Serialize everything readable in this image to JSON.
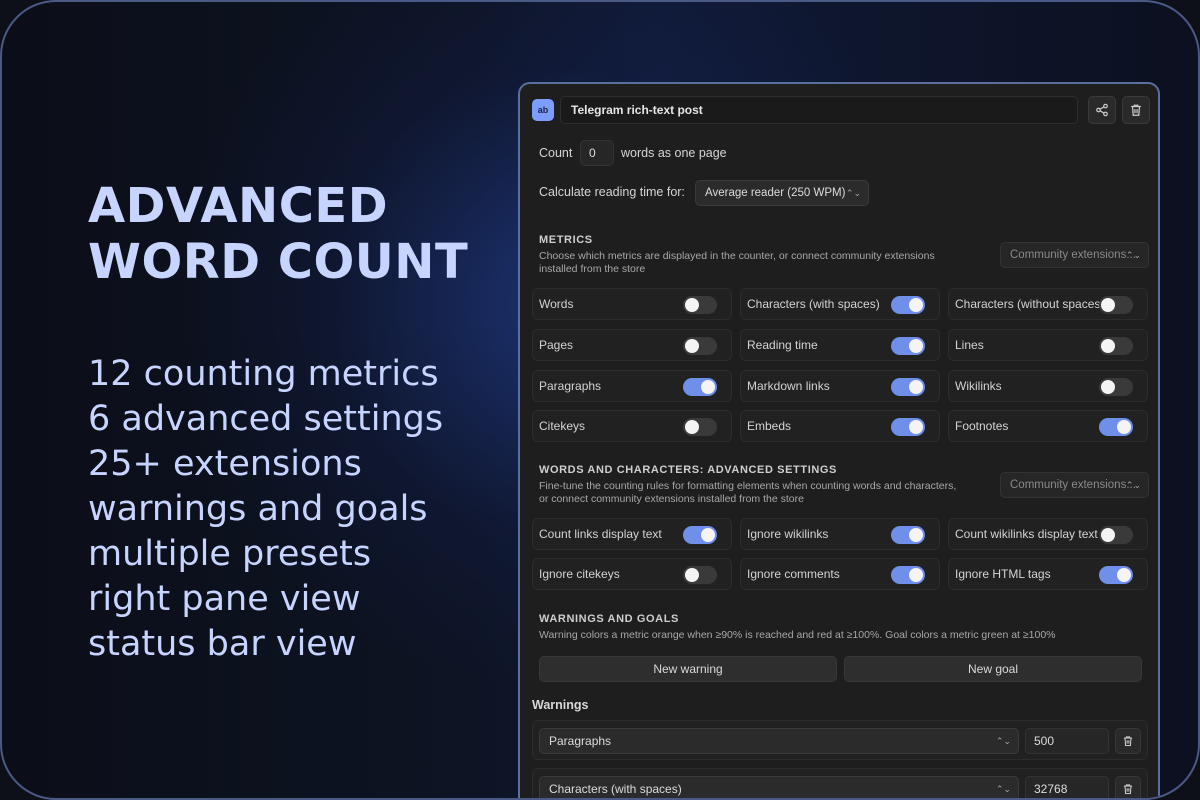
{
  "hero": {
    "title_line1": "ADVANCED",
    "title_line2": "WORD COUNT",
    "features": [
      "12 counting metrics",
      "6 advanced settings",
      "25+ extensions",
      "warnings and goals",
      "multiple presets",
      "right pane view",
      "status bar view"
    ]
  },
  "panel": {
    "app_icon": "ab",
    "preset_name": "Telegram rich-text post",
    "share_icon": "share-icon",
    "trash_icon": "trash-icon",
    "page": {
      "prefix": "Count",
      "value": "0",
      "suffix": "words as one page"
    },
    "reading": {
      "label": "Calculate reading time for:",
      "selected": "Average reader (250 WPM)"
    },
    "metrics": {
      "title": "METRICS",
      "desc_line1": "Choose which metrics are displayed in the counter, or connect community extensions",
      "desc_line2": "installed from the store",
      "extensions_label": "Community extensions...",
      "items": [
        {
          "label": "Words",
          "on": false
        },
        {
          "label": "Characters (with spaces)",
          "on": true
        },
        {
          "label": "Characters (without spaces)",
          "on": false
        },
        {
          "label": "Pages",
          "on": false
        },
        {
          "label": "Reading time",
          "on": true
        },
        {
          "label": "Lines",
          "on": false
        },
        {
          "label": "Paragraphs",
          "on": true
        },
        {
          "label": "Markdown links",
          "on": true
        },
        {
          "label": "Wikilinks",
          "on": false
        },
        {
          "label": "Citekeys",
          "on": false
        },
        {
          "label": "Embeds",
          "on": true
        },
        {
          "label": "Footnotes",
          "on": true
        }
      ]
    },
    "advanced": {
      "title": "WORDS AND CHARACTERS: ADVANCED SETTINGS",
      "desc_line1": "Fine-tune the counting rules for formatting elements when counting words and characters,",
      "desc_line2": "or connect community extensions installed from the store",
      "extensions_label": "Community extensions...",
      "items": [
        {
          "label": "Count links display text",
          "on": true
        },
        {
          "label": "Ignore wikilinks",
          "on": true
        },
        {
          "label": "Count wikilinks display text",
          "on": false
        },
        {
          "label": "Ignore citekeys",
          "on": false
        },
        {
          "label": "Ignore comments",
          "on": true
        },
        {
          "label": "Ignore HTML tags",
          "on": true
        }
      ]
    },
    "goals": {
      "title": "WARNINGS AND GOALS",
      "desc": "Warning colors a metric orange when ≥90% is reached and red at ≥100%. Goal colors a metric green at ≥100%",
      "new_warning": "New warning",
      "new_goal": "New goal"
    },
    "warnings": {
      "title": "Warnings",
      "rows": [
        {
          "metric": "Paragraphs",
          "value": "500"
        },
        {
          "metric": "Characters (with spaces)",
          "value": "32768"
        }
      ]
    }
  }
}
